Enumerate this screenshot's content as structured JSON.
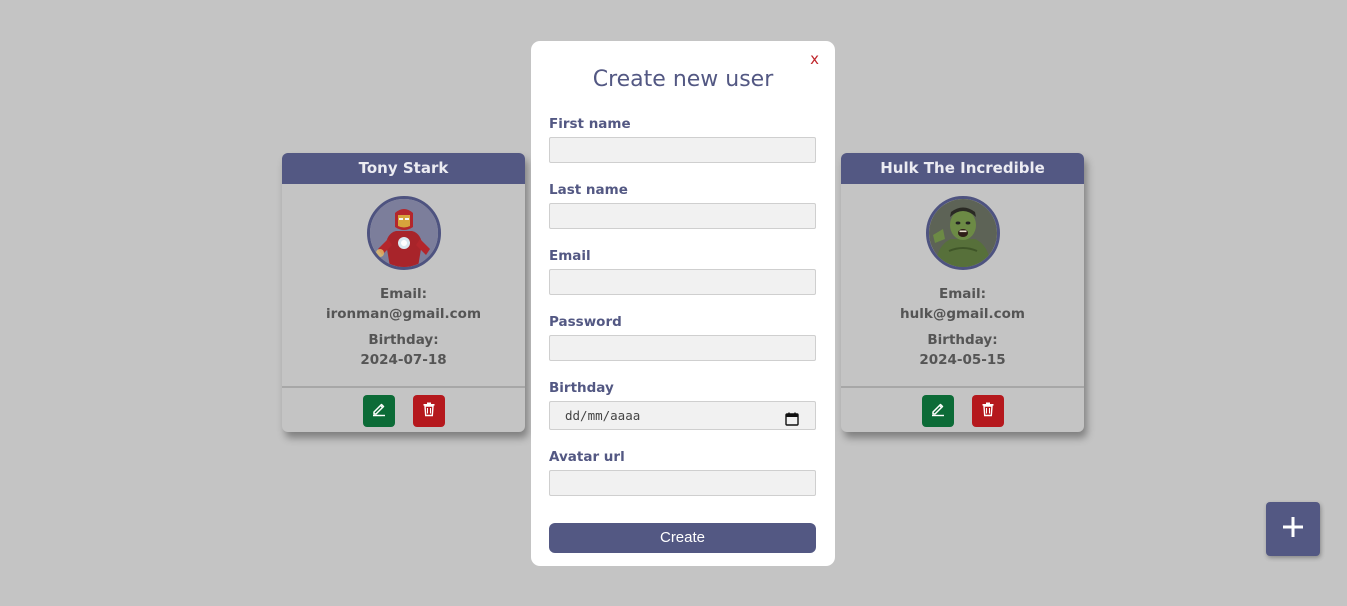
{
  "users": [
    {
      "name": "Tony Stark",
      "email_label": "Email:",
      "email": "ironman@gmail.com",
      "birthday_label": "Birthday:",
      "birthday": "2024-07-18",
      "avatar_icon": "ironman-avatar"
    },
    {
      "name": "Hulk The Incredible",
      "email_label": "Email:",
      "email": "hulk@gmail.com",
      "birthday_label": "Birthday:",
      "birthday": "2024-05-15",
      "avatar_icon": "hulk-avatar"
    }
  ],
  "modal": {
    "title": "Create new user",
    "close_label": "x",
    "fields": {
      "first_name": {
        "label": "First name",
        "value": ""
      },
      "last_name": {
        "label": "Last name",
        "value": ""
      },
      "email": {
        "label": "Email",
        "value": ""
      },
      "password": {
        "label": "Password",
        "value": ""
      },
      "birthday": {
        "label": "Birthday",
        "placeholder": "dd/mm/aaaa"
      },
      "avatar_url": {
        "label": "Avatar url",
        "value": ""
      }
    },
    "submit_label": "Create"
  },
  "fab": {
    "icon": "plus-icon"
  },
  "colors": {
    "background": "#c4c4c4",
    "primary": "#535883",
    "edit": "#0c6b37",
    "delete": "#b5181d",
    "close": "#c0262c"
  }
}
